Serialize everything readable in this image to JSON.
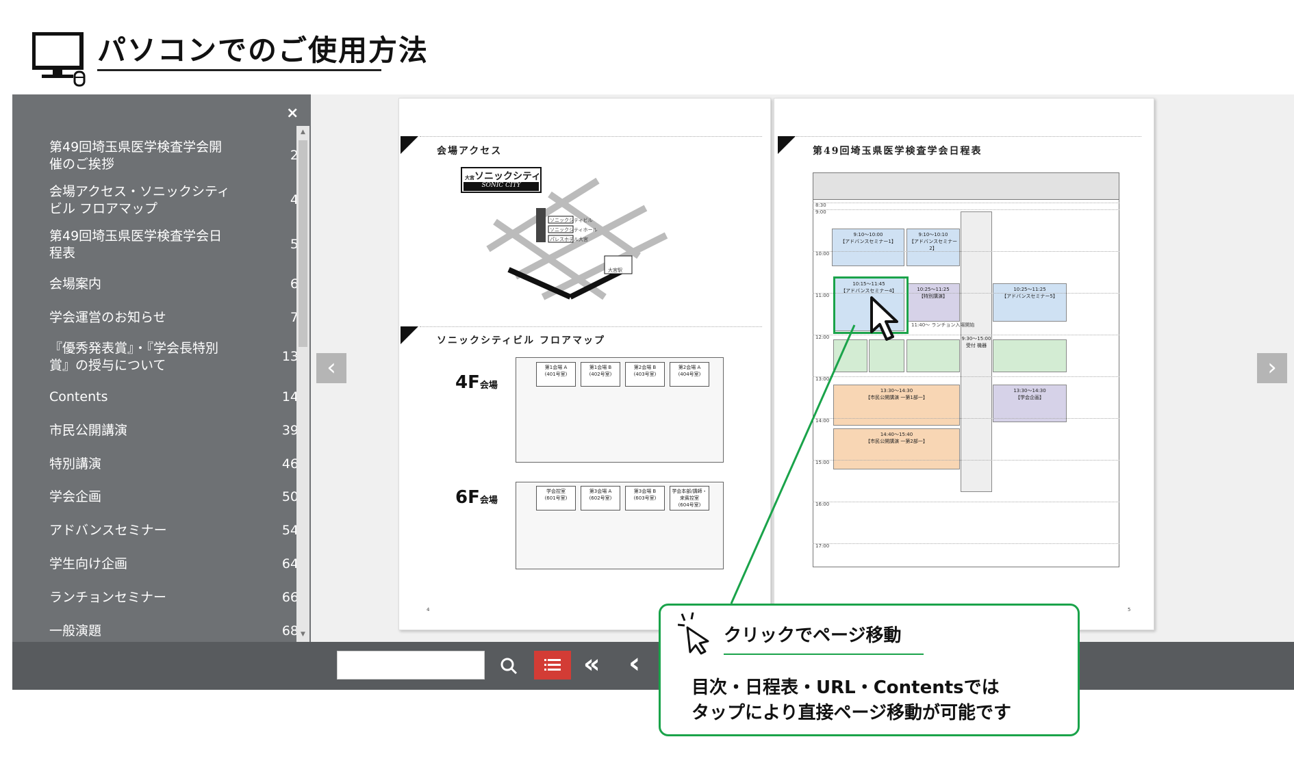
{
  "heading": {
    "title": "パソコンでのご使用方法",
    "icon": "computer-monitor-icon"
  },
  "sidebar": {
    "close_label": "×",
    "items": [
      {
        "label": "第49回埼玉県医学検査学会開催のご挨拶",
        "page": "2"
      },
      {
        "label": "会場アクセス・ソニックシティビル フロアマップ",
        "page": "4"
      },
      {
        "label": "第49回埼玉県医学検査学会日程表",
        "page": "5"
      },
      {
        "label": "会場案内",
        "page": "6"
      },
      {
        "label": "学会運営のお知らせ",
        "page": "7"
      },
      {
        "label": "『優秀発表賞』・『学会長特別賞』の授与について",
        "page": "13"
      },
      {
        "label": "Contents",
        "page": "14"
      },
      {
        "label": "市民公開講演",
        "page": "39"
      },
      {
        "label": "特別講演",
        "page": "46"
      },
      {
        "label": "学会企画",
        "page": "50"
      },
      {
        "label": "アドバンスセミナー",
        "page": "54"
      },
      {
        "label": "学生向け企画",
        "page": "64"
      },
      {
        "label": "ランチョンセミナー",
        "page": "66"
      },
      {
        "label": "一般演題",
        "page": "68"
      }
    ]
  },
  "toolbar": {
    "search_value": "",
    "search_icon": "magnifier-icon",
    "menu_icon": "list-icon",
    "first_label": "«",
    "prev_label": "‹",
    "accent": "#d33c35"
  },
  "nav": {
    "prev_label": "‹",
    "next_label": "›"
  },
  "left_page": {
    "access_title": "会場アクセス",
    "access_logo_small": "大宮",
    "access_logo": "ソニックシティ",
    "access_logo_en": "SONIC CITY",
    "map_labels": [
      "ソニックシティビル",
      "ソニックシティホール",
      "パレスホテル大宮",
      "大宮駅"
    ],
    "floormap_title": "ソニックシティビル フロアマップ",
    "floor4": "4F",
    "floor6": "6F",
    "floor_suffix": "会場",
    "rooms4": [
      "第1会場 A",
      "第1会場 B",
      "第2会場 B",
      "第2会場 A"
    ],
    "rooms4_sub": [
      "(401号室)",
      "(402号室)",
      "(403号室)",
      "(404号室)"
    ],
    "rooms6": [
      "学会控室",
      "第3会場 A",
      "第3会場 B",
      "学会本部/講師・来賓控室"
    ],
    "rooms6_sub": [
      "(601号室)",
      "(602号室)",
      "(603号室)",
      "(604号室)"
    ],
    "folio": "4"
  },
  "right_page": {
    "title": "第49回埼玉県医学検査学会日程表",
    "times": [
      "8:30",
      "9:00",
      "10:00",
      "11:00",
      "12:00",
      "13:00",
      "14:00",
      "15:00",
      "16:00",
      "17:00"
    ],
    "blocks": {
      "adv1": "9:10〜10:00\n【アドバンスセミナー1】",
      "adv2": "9:10〜10:10\n【アドバンスセミナー2】",
      "adv4": "10:15〜11:45\n【アドバンスセミナー4】",
      "special": "10:25〜11:25\n【特別講演】",
      "adv5": "10:25〜11:25\n【アドバンスセミナー5】",
      "lunch": "11:40〜 ランチョン入場開始",
      "public1": "13:30〜14:30\n【市民公開講演 一第1部一】",
      "public2": "14:40〜15:40\n【市民公開講演 一第2部一】",
      "society": "13:30〜14:30\n【学会企画】",
      "reception": "9:30〜15:00\n受付 機器"
    },
    "folio": "5"
  },
  "callout": {
    "title": "クリックでページ移動",
    "line1": "目次・日程表・URL・Contentsでは",
    "line2": "タップにより直接ページ移動が可能です",
    "color": "#1aa34a",
    "icon": "cursor-click-icon"
  }
}
